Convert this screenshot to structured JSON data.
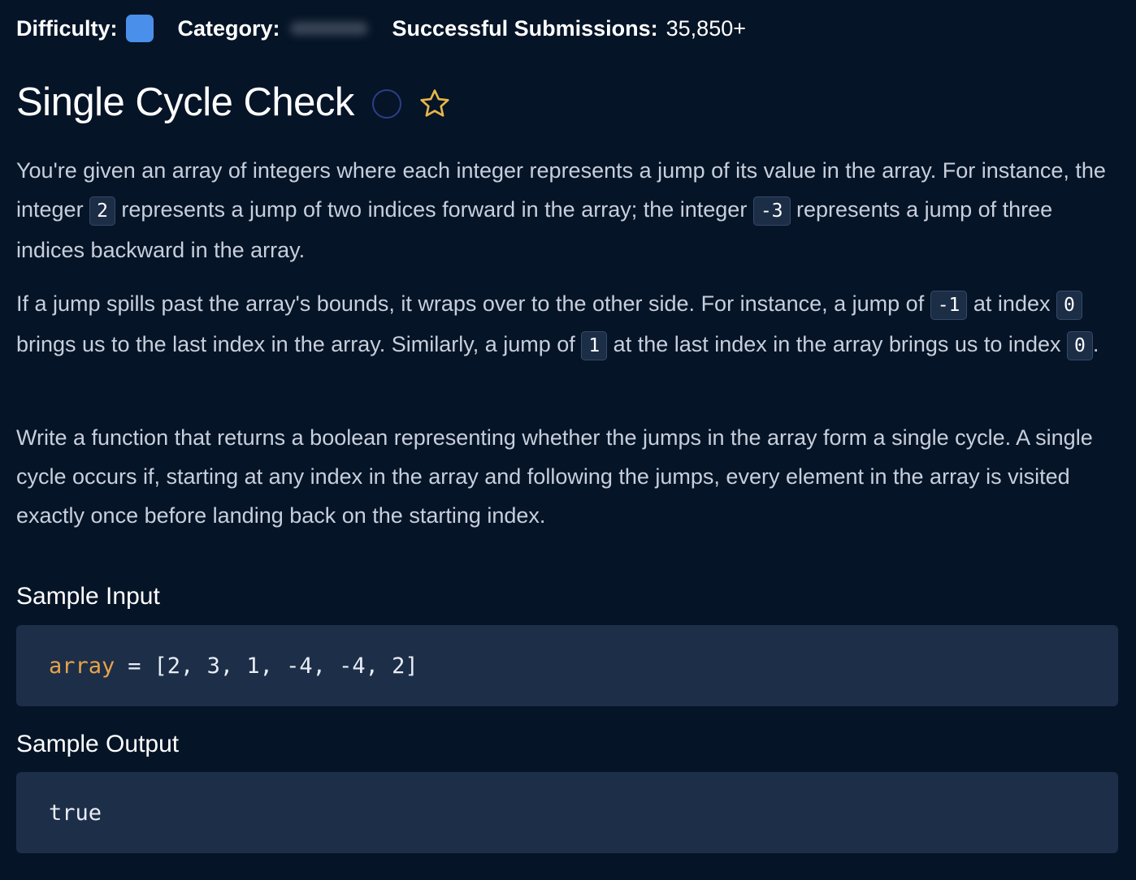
{
  "meta": {
    "difficulty_label": "Difficulty:",
    "category_label": "Category:",
    "submissions_label": "Successful Submissions:",
    "submissions_value": "35,850+",
    "difficulty_color": "#4a90ea"
  },
  "problem": {
    "title": "Single Cycle Check",
    "status_icon": "circle-icon",
    "favorite_icon": "star-icon"
  },
  "description": {
    "p1": {
      "t1": "You're given an array of integers where each integer represents a jump of its value in the array. For instance, the integer ",
      "c1": "2",
      "t2": " represents a jump of two indices forward in the array; the integer ",
      "c2": "-3",
      "t3": " represents a jump of three indices backward in the array."
    },
    "p2": {
      "t1": "If a jump spills past the array's bounds, it wraps over to the other side. For instance, a jump of ",
      "c1": "-1",
      "t2": " at index ",
      "c2": "0",
      "t3": " brings us to the last index in the array. Similarly, a jump of ",
      "c3": "1",
      "t4": " at the last index in the array brings us to index ",
      "c4": "0",
      "t5": "."
    },
    "p3": "Write a function that returns a boolean representing whether the jumps in the array form a single cycle. A single cycle occurs if, starting at any index in the array and following the jumps, every element in the array is visited exactly once before landing back on the starting index."
  },
  "sample_input": {
    "heading": "Sample Input",
    "var_name": "array",
    "equals": "=",
    "value": "[2, 3, 1, -4, -4, 2]"
  },
  "sample_output": {
    "heading": "Sample Output",
    "value": "true"
  }
}
